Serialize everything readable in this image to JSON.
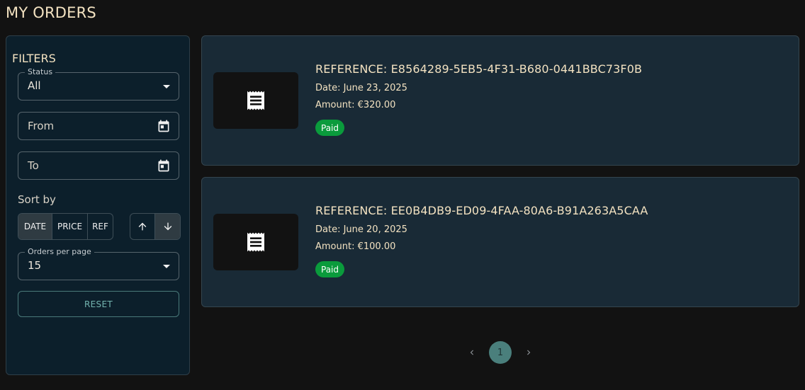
{
  "page": {
    "title": "MY ORDERS"
  },
  "filters": {
    "title": "FILTERS",
    "status": {
      "legend": "Status",
      "value": "All"
    },
    "from": {
      "placeholder": "From"
    },
    "to": {
      "placeholder": "To"
    },
    "sort_label": "Sort by",
    "sort_options": [
      {
        "label": "DATE",
        "active": true
      },
      {
        "label": "PRICE",
        "active": false
      },
      {
        "label": "REF",
        "active": false
      }
    ],
    "direction": {
      "selected": "descending"
    },
    "per_page": {
      "legend": "Orders per page",
      "value": "15"
    },
    "reset_label": "RESET"
  },
  "orders": [
    {
      "reference": "REFERENCE: E8564289-5EB5-4F31-B680-0441BBC73F0B",
      "date": "Date: June 23, 2025",
      "amount": "Amount: €320.00",
      "status": "Paid"
    },
    {
      "reference": "REFERENCE: EE0B4DB9-ED09-4FAA-80A6-B91A263A5CAA",
      "date": "Date: June 20, 2025",
      "amount": "Amount: €100.00",
      "status": "Paid"
    }
  ],
  "pagination": {
    "current_page": "1"
  },
  "icons": {
    "thumbnail": "receipt-icon",
    "date_picker": "calendar-icon"
  },
  "colors": {
    "accent": "#4a7f7c",
    "paid": "#0a9b3c",
    "title": "#f3e2c1"
  }
}
